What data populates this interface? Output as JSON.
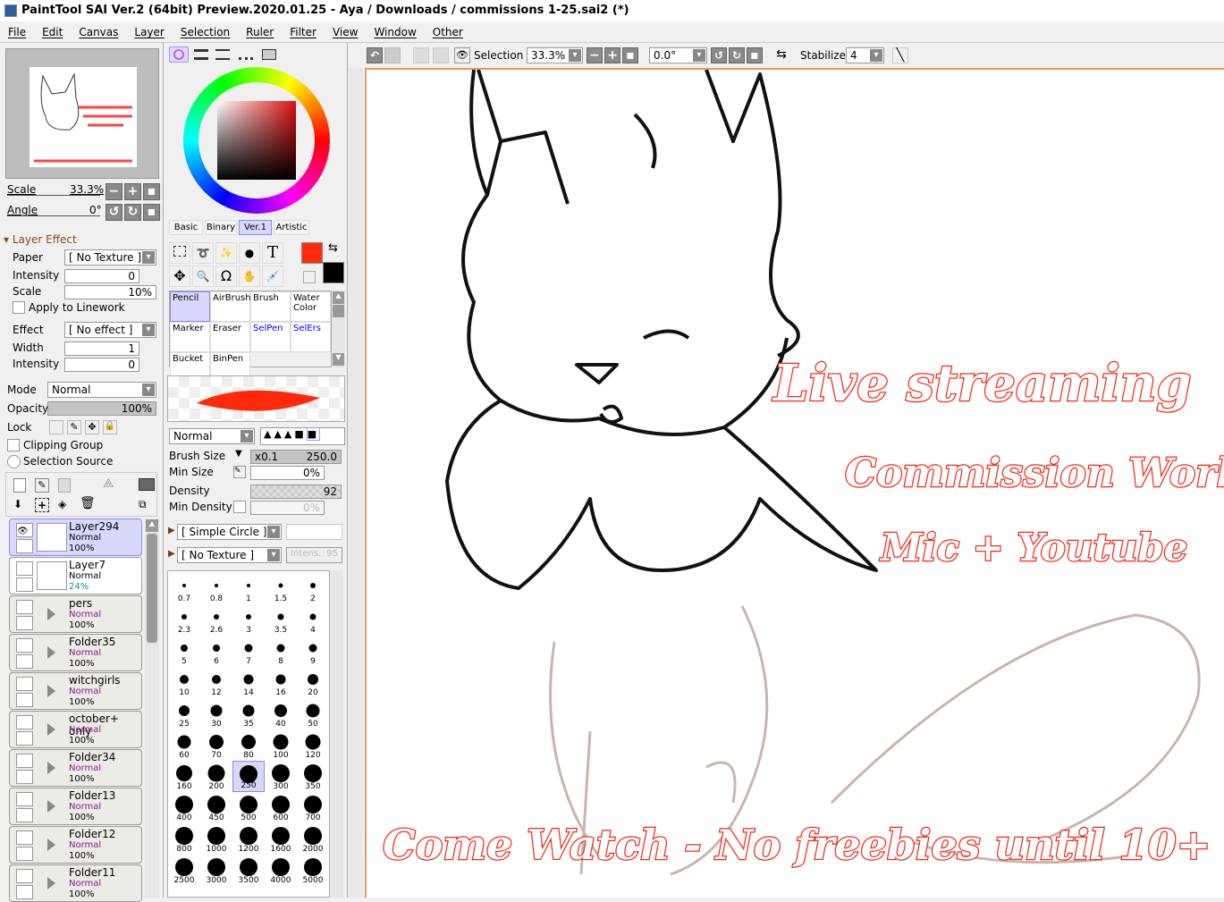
{
  "title": "PaintTool SAI Ver.2 (64bit) Preview.2020.01.25 - Aya / Downloads / commissions 1-25.sai2 (*)",
  "menu": [
    "File",
    "Edit",
    "Canvas",
    "Layer",
    "Selection",
    "Ruler",
    "Filter",
    "View",
    "Window",
    "Other"
  ],
  "navigator": {
    "scale_label": "Scale",
    "scale_value": "33.3%",
    "angle_label": "Angle",
    "angle_value": "0°"
  },
  "layer_effect": {
    "header": "Layer Effect",
    "paper_label": "Paper",
    "paper_value": "[ No Texture ]",
    "intensity_label": "Intensity",
    "intensity_value": "0",
    "scale_label": "Scale",
    "scale_value": "10%",
    "apply_linework": "Apply to Linework",
    "effect_label": "Effect",
    "effect_value": "[ No effect ]",
    "width_label": "Width",
    "width_value": "1",
    "intensity2_label": "Intensity",
    "intensity2_value": "0"
  },
  "layer_props": {
    "mode_label": "Mode",
    "mode_value": "Normal",
    "opacity_label": "Opacity",
    "opacity_value": "100%",
    "lock_label": "Lock",
    "clipping": "Clipping Group",
    "selection_source": "Selection Source"
  },
  "layers": [
    {
      "name": "Layer294",
      "mode": "Normal",
      "opacity": "100%",
      "type": "layer",
      "selected": true
    },
    {
      "name": "Layer7",
      "mode": "Normal",
      "opacity": "24%",
      "type": "layer"
    },
    {
      "name": "pers",
      "mode": "Normal",
      "opacity": "100%",
      "type": "folder"
    },
    {
      "name": "Folder35",
      "mode": "Normal",
      "opacity": "100%",
      "type": "folder"
    },
    {
      "name": "witchgirls",
      "mode": "Normal",
      "opacity": "100%",
      "type": "folder"
    },
    {
      "name": "october+ only",
      "mode": "Normal",
      "opacity": "100%",
      "type": "folder"
    },
    {
      "name": "Folder34",
      "mode": "Normal",
      "opacity": "100%",
      "type": "folder"
    },
    {
      "name": "Folder13",
      "mode": "Normal",
      "opacity": "100%",
      "type": "folder"
    },
    {
      "name": "Folder12",
      "mode": "Normal",
      "opacity": "100%",
      "type": "folder"
    },
    {
      "name": "Folder11",
      "mode": "Normal",
      "opacity": "100%",
      "type": "folder"
    }
  ],
  "tool_tabs": [
    "Basic",
    "Binary",
    "Ver.1",
    "Artistic"
  ],
  "tool_tab_active": "Ver.1",
  "colors": {
    "primary": "#ff2a0a",
    "secondary": "#000000",
    "accent": "#d8d8ff"
  },
  "brushes": [
    {
      "name": "Pencil",
      "selected": true
    },
    {
      "name": "AirBrush"
    },
    {
      "name": "Brush"
    },
    {
      "name": "Water Color"
    },
    {
      "name": "Marker"
    },
    {
      "name": "Eraser"
    },
    {
      "name": "SelPen",
      "blue": true
    },
    {
      "name": "SelErs",
      "blue": true
    },
    {
      "name": "Bucket"
    },
    {
      "name": "BinPen"
    }
  ],
  "brush": {
    "blend_mode": "Normal",
    "size_label": "Brush Size",
    "size_mult": "x0.1",
    "size_value": "250.0",
    "min_size_label": "Min Size",
    "min_size_value": "0%",
    "density_label": "Density",
    "density_value": "92",
    "min_density_label": "Min Density",
    "min_density_value": "0%",
    "shape": "[ Simple Circle ]",
    "texture": "[ No Texture ]",
    "texture_intensity_label": "Intens.",
    "texture_intensity_value": "95"
  },
  "brush_sizes": [
    "0.7",
    "0.8",
    "1",
    "1.5",
    "2",
    "2.3",
    "2.6",
    "3",
    "3.5",
    "4",
    "5",
    "6",
    "7",
    "8",
    "9",
    "10",
    "12",
    "14",
    "16",
    "20",
    "25",
    "30",
    "35",
    "40",
    "50",
    "60",
    "70",
    "80",
    "100",
    "120",
    "160",
    "200",
    "250",
    "300",
    "350",
    "400",
    "450",
    "500",
    "600",
    "700",
    "800",
    "1000",
    "1200",
    "1600",
    "2000",
    "2500",
    "3000",
    "3500",
    "4000",
    "5000"
  ],
  "brush_size_selected": "250",
  "toolbar": {
    "selection_label": "Selection",
    "zoom_value": "33.3%",
    "rotation_value": "0.0°",
    "stabilizer_label": "Stabilizer",
    "stabilizer_value": "4"
  },
  "canvas_text": {
    "line1": "Live streaming",
    "line2": "Commission Work",
    "line3": "Mic + Youtube",
    "line4": "Come Watch - No freebies until 10+"
  }
}
